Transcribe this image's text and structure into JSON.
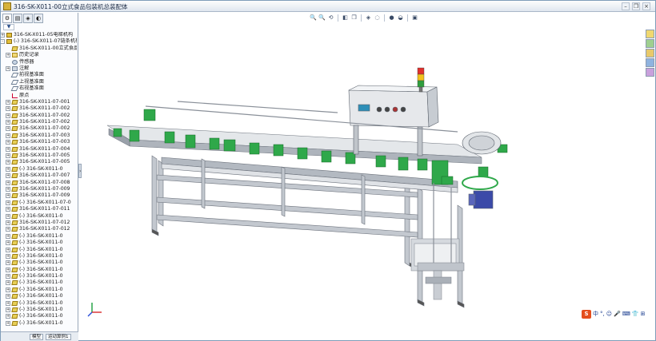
{
  "window": {
    "title": "316-SK-X011-00立式食品包装机总装配体"
  },
  "view_toolbar": {
    "icons": [
      "zoom-fit-icon",
      "zoom-area-icon",
      "previous-view-icon",
      "section-view-icon",
      "view-orientation-icon",
      "display-style-icon",
      "hide-show-icon",
      "edit-appearance-icon",
      "scene-icon",
      "view-settings-icon"
    ]
  },
  "feature_tree": {
    "tabs": [
      "feature-manager",
      "property-manager",
      "configuration-manager",
      "display-manager"
    ],
    "filter_label": "▼",
    "items": [
      {
        "label": "316-SK-X011-05电梯机构",
        "level": 0,
        "type": "asm",
        "toggle": "+"
      },
      {
        "label": "(-) 316-SK-X011-07链条机构",
        "level": 0,
        "type": "asm",
        "toggle": "-"
      },
      {
        "label": "316-SK-X011-00立式食品",
        "level": 1,
        "type": "part",
        "toggle": ""
      },
      {
        "label": "历史记录",
        "level": 1,
        "type": "folder",
        "toggle": "+"
      },
      {
        "label": "传感器",
        "level": 1,
        "type": "sensor",
        "toggle": ""
      },
      {
        "label": "注解",
        "level": 1,
        "type": "note",
        "toggle": "+"
      },
      {
        "label": "前视基准面",
        "level": 1,
        "type": "plane",
        "toggle": ""
      },
      {
        "label": "上视基准面",
        "level": 1,
        "type": "plane",
        "toggle": ""
      },
      {
        "label": "右视基准面",
        "level": 1,
        "type": "plane",
        "toggle": ""
      },
      {
        "label": "原点",
        "level": 1,
        "type": "origin",
        "toggle": ""
      },
      {
        "label": "316-SK-X011-07-001",
        "level": 1,
        "type": "part",
        "toggle": "+"
      },
      {
        "label": "316-SK-X011-07-002",
        "level": 1,
        "type": "part",
        "toggle": "+"
      },
      {
        "label": "316-SK-X011-07-002",
        "level": 1,
        "type": "part",
        "toggle": "+"
      },
      {
        "label": "316-SK-X011-07-002",
        "level": 1,
        "type": "part",
        "toggle": "+"
      },
      {
        "label": "316-SK-X011-07-002",
        "level": 1,
        "type": "part",
        "toggle": "+"
      },
      {
        "label": "316-SK-X011-07-003",
        "level": 1,
        "type": "part",
        "toggle": "+"
      },
      {
        "label": "316-SK-X011-07-003",
        "level": 1,
        "type": "part",
        "toggle": "+"
      },
      {
        "label": "316-SK-X011-07-004",
        "level": 1,
        "type": "part",
        "toggle": "+"
      },
      {
        "label": "316-SK-X011-07-005",
        "level": 1,
        "type": "part",
        "toggle": "+"
      },
      {
        "label": "316-SK-X011-07-005",
        "level": 1,
        "type": "part",
        "toggle": "+"
      },
      {
        "label": "(-) 316-SK-X011-0",
        "level": 1,
        "type": "part",
        "toggle": "+"
      },
      {
        "label": "316-SK-X011-07-007",
        "level": 1,
        "type": "part",
        "toggle": "+"
      },
      {
        "label": "316-SK-X011-07-008",
        "level": 1,
        "type": "part",
        "toggle": "+"
      },
      {
        "label": "316-SK-X011-07-009",
        "level": 1,
        "type": "part",
        "toggle": "+"
      },
      {
        "label": "316-SK-X011-07-009",
        "level": 1,
        "type": "part",
        "toggle": "+"
      },
      {
        "label": "(-) 316-SK-X011-07-0",
        "level": 1,
        "type": "part",
        "toggle": "+"
      },
      {
        "label": "316-SK-X011-07-011",
        "level": 1,
        "type": "part",
        "toggle": "+"
      },
      {
        "label": "(-) 316-SK-X011-0",
        "level": 1,
        "type": "part",
        "toggle": "+"
      },
      {
        "label": "316-SK-X011-07-012",
        "level": 1,
        "type": "part",
        "toggle": "+"
      },
      {
        "label": "316-SK-X011-07-012",
        "level": 1,
        "type": "part",
        "toggle": "+"
      },
      {
        "label": "(-) 316-SK-X011-0",
        "level": 1,
        "type": "part",
        "toggle": "+"
      },
      {
        "label": "(-) 316-SK-X011-0",
        "level": 1,
        "type": "part",
        "toggle": "+"
      },
      {
        "label": "(-) 316-SK-X011-0",
        "level": 1,
        "type": "part",
        "toggle": "+"
      },
      {
        "label": "(-) 316-SK-X011-0",
        "level": 1,
        "type": "part",
        "toggle": "+"
      },
      {
        "label": "(-) 316-SK-X011-0",
        "level": 1,
        "type": "part",
        "toggle": "+"
      },
      {
        "label": "(-) 316-SK-X011-0",
        "level": 1,
        "type": "part",
        "toggle": "+"
      },
      {
        "label": "(-) 316-SK-X011-0",
        "level": 1,
        "type": "part",
        "toggle": "+"
      },
      {
        "label": "(-) 316-SK-X011-0",
        "level": 1,
        "type": "part",
        "toggle": "+"
      },
      {
        "label": "(-) 316-SK-X011-0",
        "level": 1,
        "type": "part",
        "toggle": "+"
      },
      {
        "label": "(-) 316-SK-X011-0",
        "level": 1,
        "type": "part",
        "toggle": "+"
      },
      {
        "label": "(-) 316-SK-X011-0",
        "level": 1,
        "type": "part",
        "toggle": "+"
      },
      {
        "label": "(-) 316-SK-X011-0",
        "level": 1,
        "type": "part",
        "toggle": "+"
      },
      {
        "label": "(-) 316-SK-X011-0",
        "level": 1,
        "type": "part",
        "toggle": "+"
      },
      {
        "label": "(-) 316-SK-X011-0",
        "level": 1,
        "type": "part",
        "toggle": "+"
      }
    ]
  },
  "status_tabs": [
    "模型",
    "运动算例1"
  ],
  "ime": {
    "logo": "S",
    "items": [
      "中",
      "°,",
      "☺",
      "🎤",
      "⌨",
      "👕",
      "⊞"
    ]
  },
  "colors": {
    "accent_green": "#2fa84a",
    "frame_gray": "#b9bec6",
    "panel_gray": "#d7dadf"
  }
}
